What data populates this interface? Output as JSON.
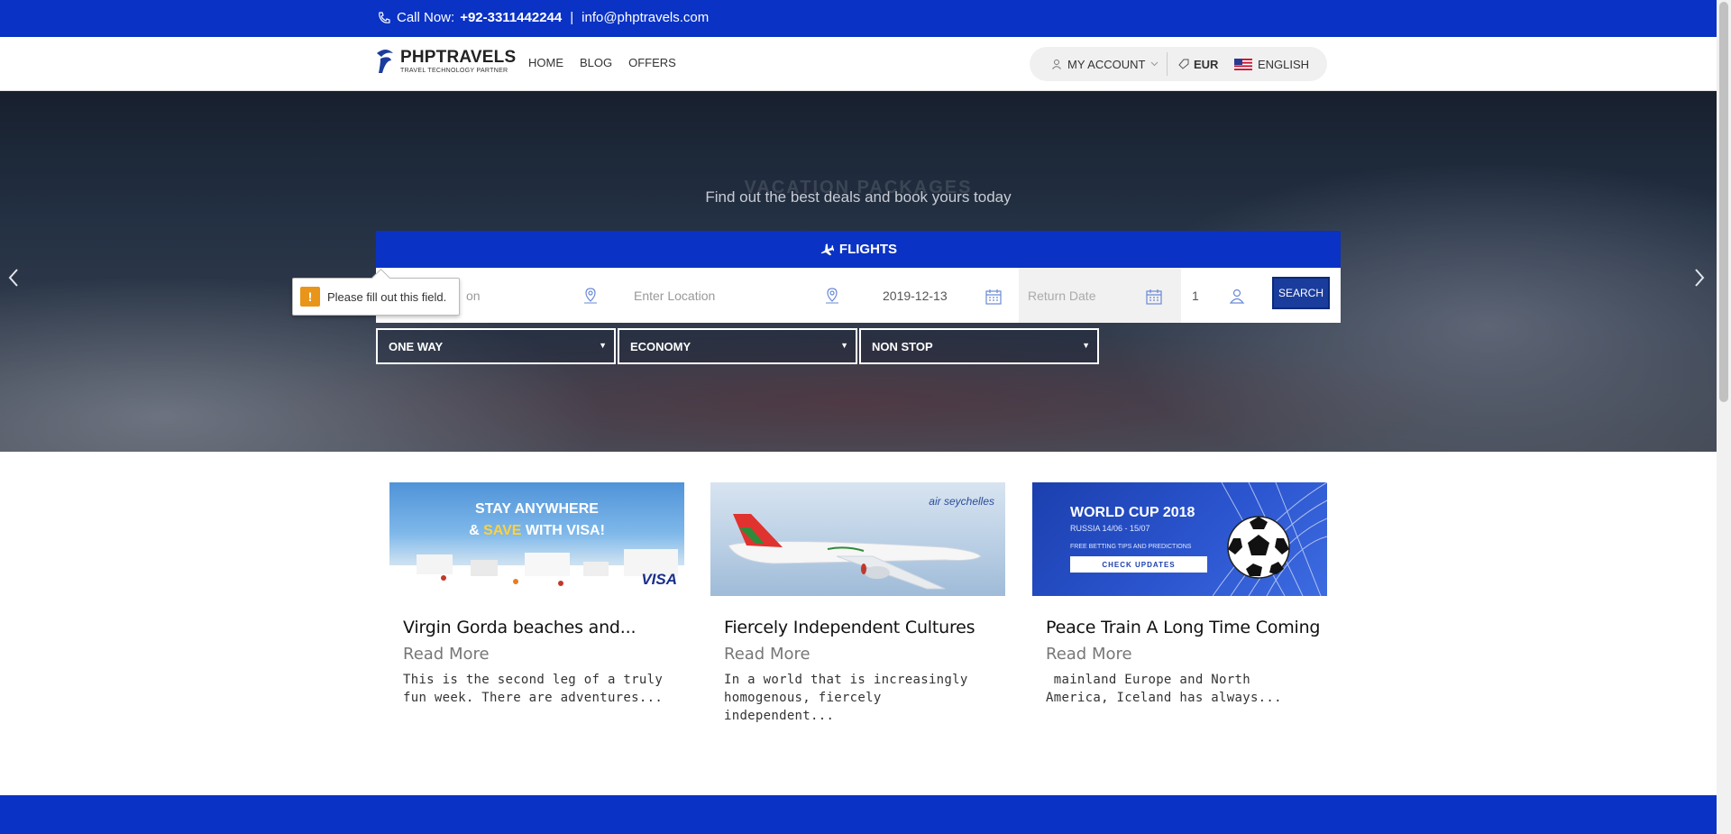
{
  "topbar": {
    "call_label": "Call Now:",
    "phone": "+92-3311442244",
    "divider": "|",
    "email": "info@phptravels.com"
  },
  "nav": {
    "logo_name": "PHPTRAVELS",
    "logo_tagline": "TRAVEL TECHNOLOGY PARTNER",
    "links": [
      "HOME",
      "BLOG",
      "OFFERS"
    ],
    "account_label": "MY ACCOUNT",
    "currency": "EUR",
    "language": "ENGLISH"
  },
  "hero": {
    "title": "VACATION PACKAGES",
    "subtitle": "Find out the best deals and book yours today"
  },
  "search": {
    "tab_label": "FLIGHTS",
    "from_placeholder": "Enter Location",
    "from_visible": "on",
    "to_placeholder": "Enter Location",
    "depart_date": "2019-12-13",
    "return_placeholder": "Return Date",
    "passengers": "1",
    "search_label": "SEARCH",
    "trip_type": "ONE WAY",
    "cabin_class": "ECONOMY",
    "stops": "NON STOP"
  },
  "tooltip": {
    "message": "Please fill out this field."
  },
  "cards": [
    {
      "image_text_line1": "STAY ANYWHERE",
      "image_text_amp": "& ",
      "image_text_save": "SAVE",
      "image_text_rest": " WITH VISA!",
      "image_brand": "VISA",
      "title": "Virgin Gorda beaches and...",
      "read_more": "Read More",
      "desc": "This is the second leg of a truly fun week. There are adventures..."
    },
    {
      "image_brand": "air seychelles",
      "title": "Fiercely Independent Cultures",
      "read_more": "Read More",
      "desc": "In a world that is increasingly homogenous, fiercely independent..."
    },
    {
      "image_title": "WORLD CUP 2018",
      "image_sub": "RUSSIA 14/06 - 15/07",
      "image_small": "FREE BETTING TIPS AND PREDICTIONS",
      "image_button": "CHECK UPDATES",
      "title": "Peace Train A Long Time Coming",
      "read_more": "Read More",
      "desc": " mainland Europe and North America, Iceland has always..."
    }
  ],
  "colors": {
    "brand_blue": "#0a32c4",
    "search_button": "#1a3c9c",
    "warning": "#e8951a"
  }
}
